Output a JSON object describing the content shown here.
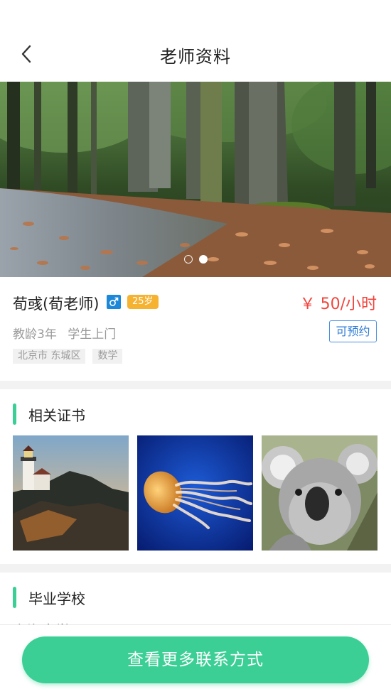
{
  "header": {
    "title": "老师资料",
    "back_icon": "chevron-left-icon"
  },
  "banner": {
    "slide_count": 2,
    "active_slide": 2
  },
  "teacher": {
    "name": "荀彧(荀老师)",
    "gender_icon": "male-icon",
    "age": "25岁",
    "price": "￥ 50/小时",
    "experience": "教龄3年",
    "teaching_mode": "学生上门",
    "status": "可预约",
    "tags": [
      "北京市 东城区",
      "数学"
    ]
  },
  "certificates": {
    "title": "相关证书",
    "images": [
      "lighthouse-photo",
      "jellyfish-photo",
      "koala-photo"
    ]
  },
  "school": {
    "title": "毕业学校",
    "name": "上海大学"
  },
  "actions": {
    "contact_label": "查看更多联系方式"
  },
  "colors": {
    "accent": "#3ccf95",
    "price": "#f2453d",
    "badge": "#f6b332",
    "gender": "#1e88d8",
    "status_border": "#4a90e2"
  }
}
